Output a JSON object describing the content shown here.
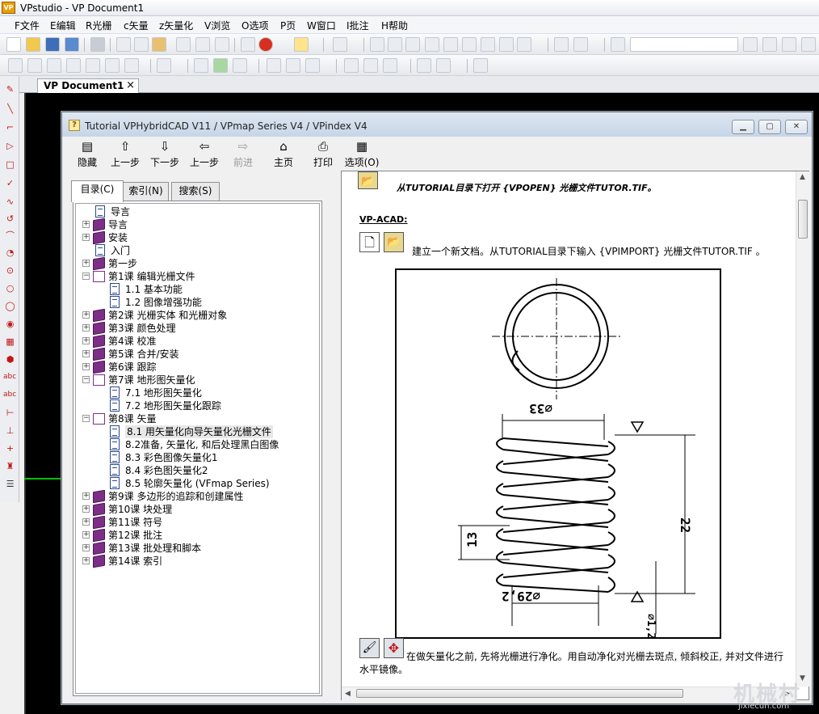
{
  "window": {
    "title": "VPstudio - VP Document1",
    "app_icon": "VP"
  },
  "menu": [
    "F文件",
    "E编辑",
    "R光栅",
    "c矢量",
    "z矢量化",
    "V浏览",
    "O选项",
    "P页",
    "W窗口",
    "I批注",
    "H帮助"
  ],
  "document_tab": {
    "label": "VP Document1",
    "close": "×"
  },
  "tutorial": {
    "title": "Tutorial VPHybridCAD V11 / VPmap Series V4 / VPindex V4",
    "toolbar": [
      {
        "label": "隐藏",
        "icon": "hide-icon",
        "glyph": "▤"
      },
      {
        "label": "上一步",
        "icon": "up-arrow-icon",
        "glyph": "⇧"
      },
      {
        "label": "下一步",
        "icon": "down-arrow-icon",
        "glyph": "⇩"
      },
      {
        "label": "上一步",
        "icon": "back-arrow-icon",
        "glyph": "⇦"
      },
      {
        "label": "前进",
        "icon": "forward-arrow-icon",
        "glyph": "⇨"
      },
      {
        "label": "主页",
        "icon": "home-icon",
        "glyph": "⌂"
      },
      {
        "label": "打印",
        "icon": "print-icon",
        "glyph": "⎙"
      },
      {
        "label": "选项(O)",
        "icon": "options-icon",
        "glyph": "▦"
      }
    ],
    "nav_tabs": [
      "目录(C)",
      "索引(N)",
      "搜索(S)"
    ],
    "tree": [
      {
        "label": "导言",
        "type": "page",
        "level": 1
      },
      {
        "label": "导言",
        "type": "book",
        "level": 0
      },
      {
        "label": "安装",
        "type": "book",
        "level": 0
      },
      {
        "label": "入门",
        "type": "page",
        "level": 1
      },
      {
        "label": "第一步",
        "type": "book",
        "level": 0
      },
      {
        "label": "第1课 编辑光栅文件",
        "type": "open",
        "level": 0
      },
      {
        "label": "1.1 基本功能",
        "type": "page",
        "level": 2
      },
      {
        "label": "1.2 图像增强功能",
        "type": "page",
        "level": 2
      },
      {
        "label": "第2课 光栅实体 和光栅对象",
        "type": "book",
        "level": 0
      },
      {
        "label": "第3课 颜色处理",
        "type": "book",
        "level": 0
      },
      {
        "label": "第4课 校准",
        "type": "book",
        "level": 0
      },
      {
        "label": "第5课 合并/安装",
        "type": "book",
        "level": 0
      },
      {
        "label": "第6课 跟踪",
        "type": "book",
        "level": 0
      },
      {
        "label": "第7课 地形图矢量化",
        "type": "open",
        "level": 0
      },
      {
        "label": "7.1 地形图矢量化",
        "type": "page",
        "level": 2
      },
      {
        "label": "7.2 地形图矢量化跟踪",
        "type": "page",
        "level": 2
      },
      {
        "label": "第8课 矢量",
        "type": "open",
        "level": 0
      },
      {
        "label": "8.1 用矢量化向导矢量化光栅文件",
        "type": "page",
        "level": 2,
        "selected": true
      },
      {
        "label": "8.2准备, 矢量化, 和后处理黑白图像",
        "type": "page",
        "level": 2
      },
      {
        "label": "8.3 彩色图像矢量化1",
        "type": "page",
        "level": 2
      },
      {
        "label": "8.4 彩色图矢量化2",
        "type": "page",
        "level": 2
      },
      {
        "label": "8.5 轮廓矢量化 (VFmap Series)",
        "type": "page",
        "level": 2
      },
      {
        "label": "第9课 多边形的追踪和创建属性",
        "type": "book",
        "level": 0
      },
      {
        "label": "第10课 块处理",
        "type": "book",
        "level": 0
      },
      {
        "label": "第11课 符号",
        "type": "book",
        "level": 0
      },
      {
        "label": "第12课 批注",
        "type": "book",
        "level": 0
      },
      {
        "label": "第13课 批处理和脚本",
        "type": "book",
        "level": 0
      },
      {
        "label": "第14课 索引",
        "type": "book",
        "level": 0
      }
    ],
    "content": {
      "open_instruction": "从TUTORIAL目录下打开 {VPOPEN} 光栅文件TUTOR.TIF。",
      "section_heading": "VP-ACAD:",
      "new_doc_text": "建立一个新文档。从TUTORIAL目录下输入 {VPIMPORT} 光栅文件TUTOR.TIF 。",
      "figure_labels": {
        "dia_top": "⌀33",
        "height": "22",
        "pitch": "13",
        "dia_bottom": "⌀29,2",
        "wire": "⌀1,2"
      },
      "cleanup_text": "在做矢量化之前, 先将光栅进行净化。用自动净化对光栅去斑点, 倾斜校正, 并对文件进行水平镜像。"
    }
  },
  "watermark": {
    "main": "机械村",
    "sub": "jixiecun.com"
  },
  "colors": {
    "book": "#7d2f87",
    "left_toolbar_icon": "#c01818",
    "canvas": "#000000",
    "accent_green": "#00c000"
  }
}
